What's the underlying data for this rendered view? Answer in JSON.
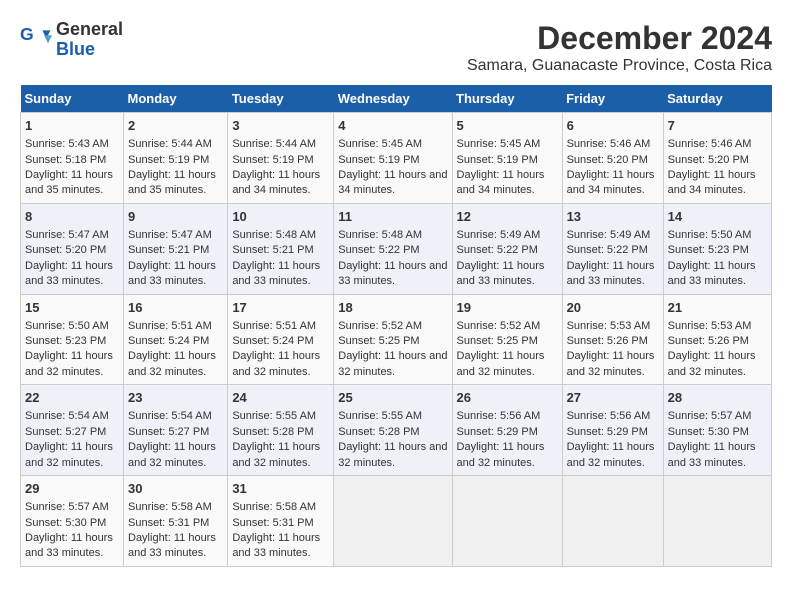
{
  "logo": {
    "text_general": "General",
    "text_blue": "Blue"
  },
  "title": "December 2024",
  "subtitle": "Samara, Guanacaste Province, Costa Rica",
  "days_of_week": [
    "Sunday",
    "Monday",
    "Tuesday",
    "Wednesday",
    "Thursday",
    "Friday",
    "Saturday"
  ],
  "weeks": [
    [
      {
        "day": "1",
        "sunrise": "5:43 AM",
        "sunset": "5:18 PM",
        "daylight": "11 hours and 35 minutes."
      },
      {
        "day": "2",
        "sunrise": "5:44 AM",
        "sunset": "5:19 PM",
        "daylight": "11 hours and 35 minutes."
      },
      {
        "day": "3",
        "sunrise": "5:44 AM",
        "sunset": "5:19 PM",
        "daylight": "11 hours and 34 minutes."
      },
      {
        "day": "4",
        "sunrise": "5:45 AM",
        "sunset": "5:19 PM",
        "daylight": "11 hours and 34 minutes."
      },
      {
        "day": "5",
        "sunrise": "5:45 AM",
        "sunset": "5:19 PM",
        "daylight": "11 hours and 34 minutes."
      },
      {
        "day": "6",
        "sunrise": "5:46 AM",
        "sunset": "5:20 PM",
        "daylight": "11 hours and 34 minutes."
      },
      {
        "day": "7",
        "sunrise": "5:46 AM",
        "sunset": "5:20 PM",
        "daylight": "11 hours and 34 minutes."
      }
    ],
    [
      {
        "day": "8",
        "sunrise": "5:47 AM",
        "sunset": "5:20 PM",
        "daylight": "11 hours and 33 minutes."
      },
      {
        "day": "9",
        "sunrise": "5:47 AM",
        "sunset": "5:21 PM",
        "daylight": "11 hours and 33 minutes."
      },
      {
        "day": "10",
        "sunrise": "5:48 AM",
        "sunset": "5:21 PM",
        "daylight": "11 hours and 33 minutes."
      },
      {
        "day": "11",
        "sunrise": "5:48 AM",
        "sunset": "5:22 PM",
        "daylight": "11 hours and 33 minutes."
      },
      {
        "day": "12",
        "sunrise": "5:49 AM",
        "sunset": "5:22 PM",
        "daylight": "11 hours and 33 minutes."
      },
      {
        "day": "13",
        "sunrise": "5:49 AM",
        "sunset": "5:22 PM",
        "daylight": "11 hours and 33 minutes."
      },
      {
        "day": "14",
        "sunrise": "5:50 AM",
        "sunset": "5:23 PM",
        "daylight": "11 hours and 33 minutes."
      }
    ],
    [
      {
        "day": "15",
        "sunrise": "5:50 AM",
        "sunset": "5:23 PM",
        "daylight": "11 hours and 32 minutes."
      },
      {
        "day": "16",
        "sunrise": "5:51 AM",
        "sunset": "5:24 PM",
        "daylight": "11 hours and 32 minutes."
      },
      {
        "day": "17",
        "sunrise": "5:51 AM",
        "sunset": "5:24 PM",
        "daylight": "11 hours and 32 minutes."
      },
      {
        "day": "18",
        "sunrise": "5:52 AM",
        "sunset": "5:25 PM",
        "daylight": "11 hours and 32 minutes."
      },
      {
        "day": "19",
        "sunrise": "5:52 AM",
        "sunset": "5:25 PM",
        "daylight": "11 hours and 32 minutes."
      },
      {
        "day": "20",
        "sunrise": "5:53 AM",
        "sunset": "5:26 PM",
        "daylight": "11 hours and 32 minutes."
      },
      {
        "day": "21",
        "sunrise": "5:53 AM",
        "sunset": "5:26 PM",
        "daylight": "11 hours and 32 minutes."
      }
    ],
    [
      {
        "day": "22",
        "sunrise": "5:54 AM",
        "sunset": "5:27 PM",
        "daylight": "11 hours and 32 minutes."
      },
      {
        "day": "23",
        "sunrise": "5:54 AM",
        "sunset": "5:27 PM",
        "daylight": "11 hours and 32 minutes."
      },
      {
        "day": "24",
        "sunrise": "5:55 AM",
        "sunset": "5:28 PM",
        "daylight": "11 hours and 32 minutes."
      },
      {
        "day": "25",
        "sunrise": "5:55 AM",
        "sunset": "5:28 PM",
        "daylight": "11 hours and 32 minutes."
      },
      {
        "day": "26",
        "sunrise": "5:56 AM",
        "sunset": "5:29 PM",
        "daylight": "11 hours and 32 minutes."
      },
      {
        "day": "27",
        "sunrise": "5:56 AM",
        "sunset": "5:29 PM",
        "daylight": "11 hours and 32 minutes."
      },
      {
        "day": "28",
        "sunrise": "5:57 AM",
        "sunset": "5:30 PM",
        "daylight": "11 hours and 33 minutes."
      }
    ],
    [
      {
        "day": "29",
        "sunrise": "5:57 AM",
        "sunset": "5:30 PM",
        "daylight": "11 hours and 33 minutes."
      },
      {
        "day": "30",
        "sunrise": "5:58 AM",
        "sunset": "5:31 PM",
        "daylight": "11 hours and 33 minutes."
      },
      {
        "day": "31",
        "sunrise": "5:58 AM",
        "sunset": "5:31 PM",
        "daylight": "11 hours and 33 minutes."
      },
      null,
      null,
      null,
      null
    ]
  ]
}
